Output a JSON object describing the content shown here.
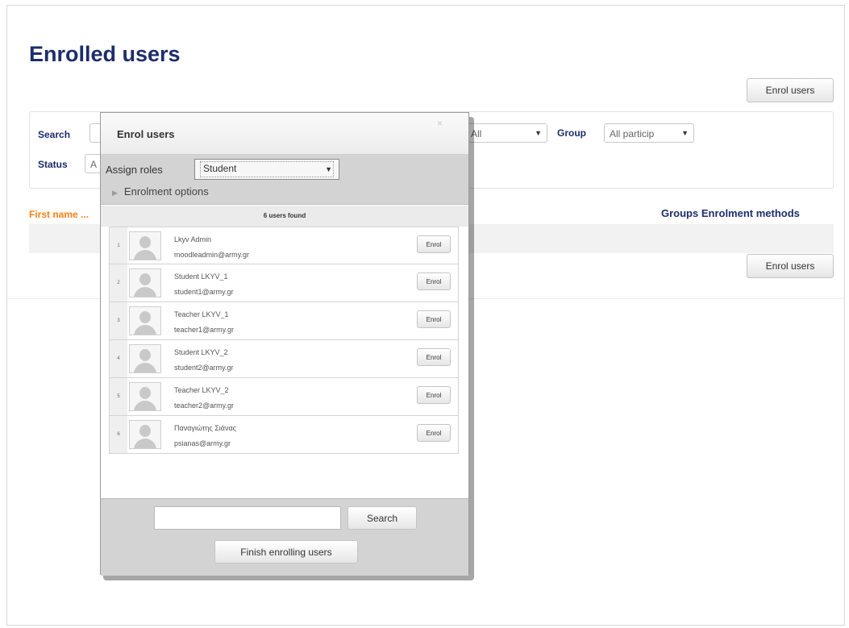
{
  "page": {
    "title": "Enrolled users",
    "enrol_button": "Enrol users"
  },
  "filters": {
    "search_label": "Search",
    "role_value": "All",
    "group_label": "Group",
    "group_value": "All particip",
    "status_label": "Status",
    "status_value_partial": "A"
  },
  "table": {
    "first_col_header": "First name ...",
    "right_headers": "Groups Enrolment methods"
  },
  "modal": {
    "title": "Enrol users",
    "close": "×",
    "assign_roles_label": "Assign roles",
    "role_value": "Student",
    "enrolment_options_label": "Enrolment options",
    "users_found": "6 users found",
    "enrol_label": "Enrol",
    "search_button": "Search",
    "search_value": "",
    "finish_button": "Finish enrolling users",
    "users": [
      {
        "num": "1",
        "name": "Lkyv Admin",
        "email": "moodleadmin@army.gr"
      },
      {
        "num": "2",
        "name": "Student LKYV_1",
        "email": "student1@army.gr"
      },
      {
        "num": "3",
        "name": "Teacher LKYV_1",
        "email": "teacher1@army.gr"
      },
      {
        "num": "4",
        "name": "Student LKYV_2",
        "email": "student2@army.gr"
      },
      {
        "num": "5",
        "name": "Teacher LKYV_2",
        "email": "teacher2@army.gr"
      },
      {
        "num": "6",
        "name": "Παναγιώτης Σιάνας",
        "email": "psianas@army.gr"
      }
    ]
  },
  "colors": {
    "heading": "#1d2d6b",
    "accent_orange": "#f98012",
    "modal_bar": "#d3d3d3"
  },
  "icons": {
    "close": "close-icon",
    "dropdown": "chevron-down-icon",
    "expand": "triangle-right-icon",
    "avatar": "user-placeholder-icon"
  }
}
